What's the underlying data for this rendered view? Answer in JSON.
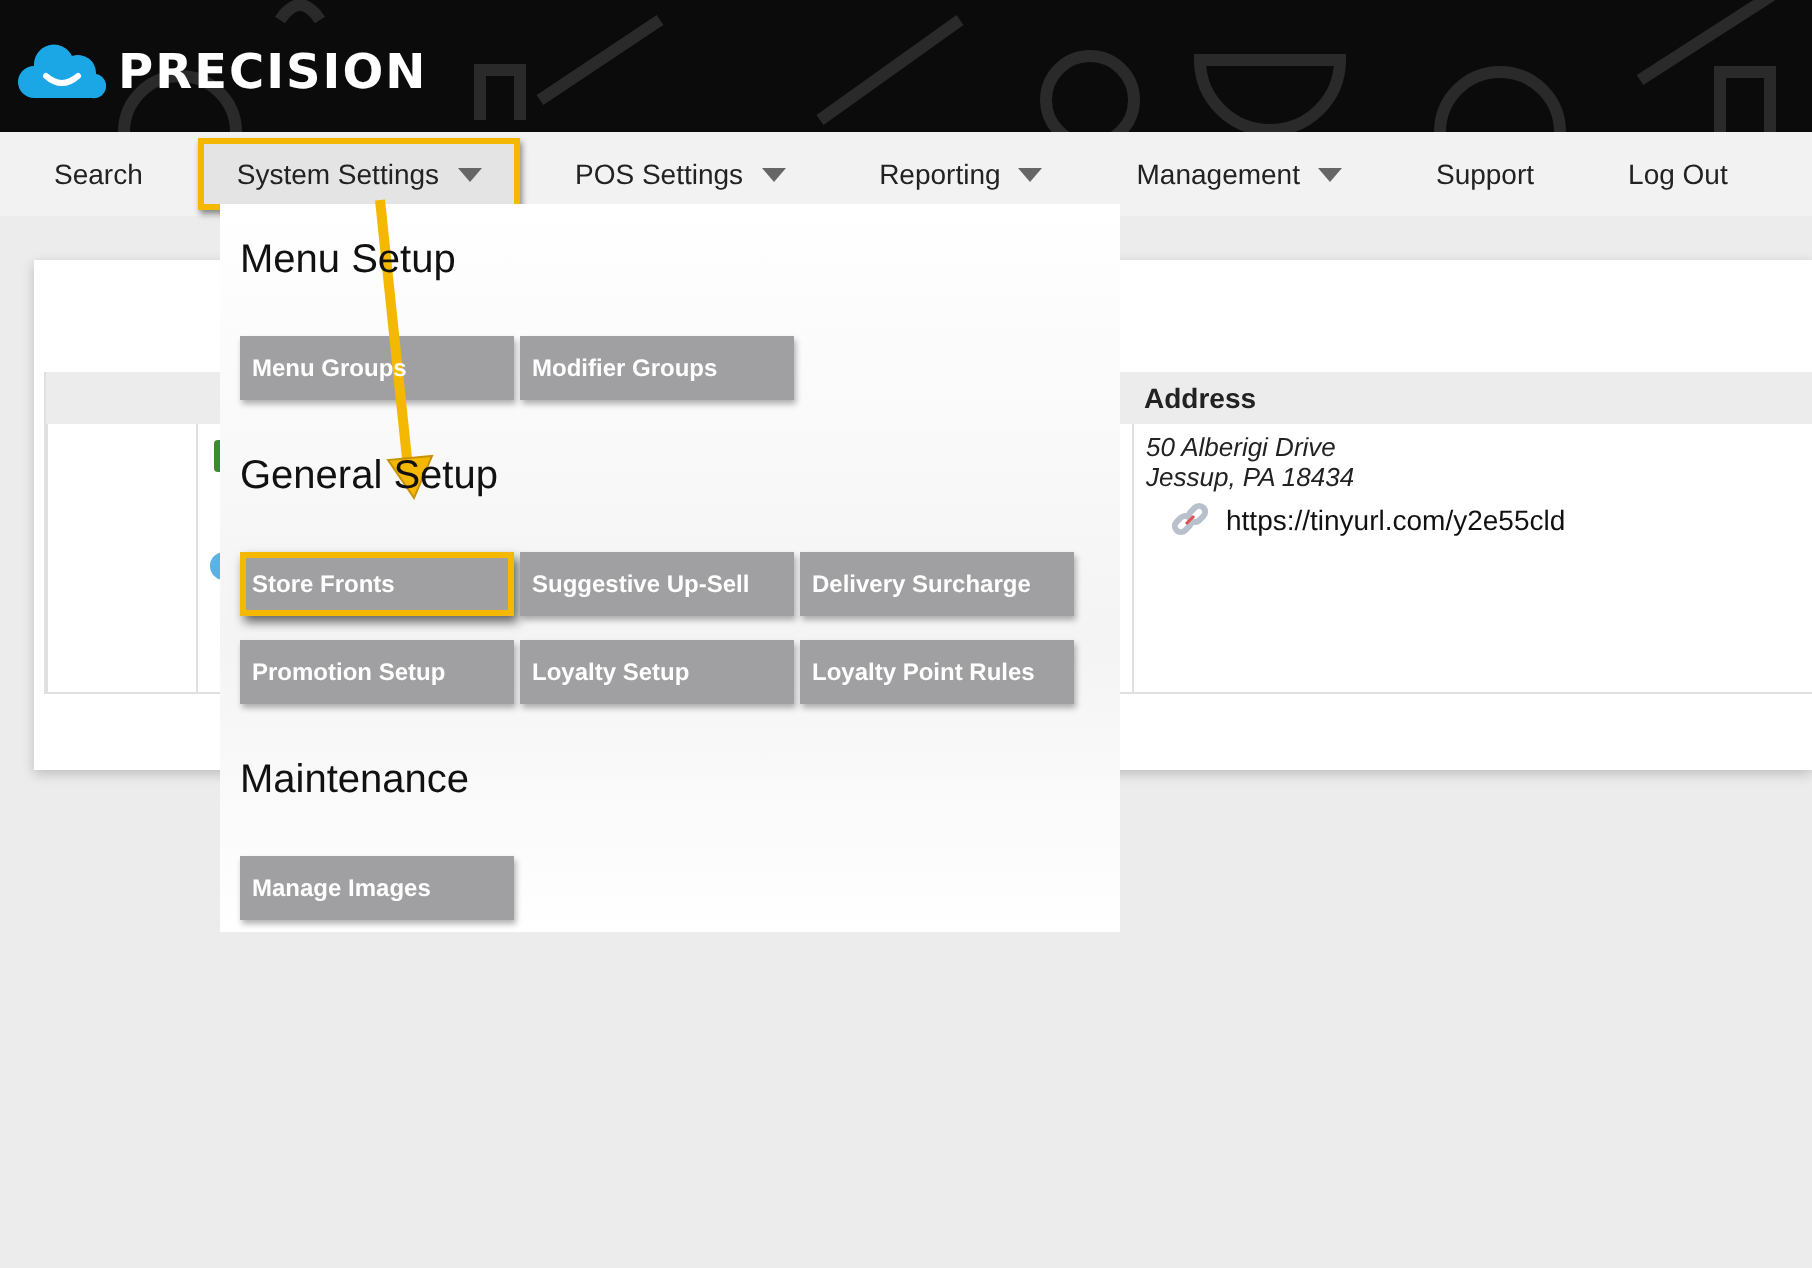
{
  "header": {
    "logo_text": "PRECISION"
  },
  "nav": [
    {
      "label": "Search",
      "has_menu": false,
      "selected": false,
      "highlighted": false
    },
    {
      "label": "System Settings",
      "has_menu": true,
      "selected": true,
      "highlighted": true
    },
    {
      "label": "POS Settings",
      "has_menu": true,
      "selected": false,
      "highlighted": false
    },
    {
      "label": "Reporting",
      "has_menu": true,
      "selected": false,
      "highlighted": false
    },
    {
      "label": "Management",
      "has_menu": true,
      "selected": false,
      "highlighted": false
    },
    {
      "label": "Support",
      "has_menu": false,
      "selected": false,
      "highlighted": false
    },
    {
      "label": "Log Out",
      "has_menu": false,
      "selected": false,
      "highlighted": false
    }
  ],
  "dropdown": {
    "sections": [
      {
        "title": "Menu Setup",
        "items": [
          {
            "label": "Menu Groups",
            "highlighted": false
          },
          {
            "label": "Modifier Groups",
            "highlighted": false
          }
        ]
      },
      {
        "title": "General Setup",
        "items": [
          {
            "label": "Store Fronts",
            "highlighted": true
          },
          {
            "label": "Suggestive Up-Sell",
            "highlighted": false
          },
          {
            "label": "Delivery Surcharge",
            "highlighted": false
          },
          {
            "label": "Promotion Setup",
            "highlighted": false
          },
          {
            "label": "Loyalty Setup",
            "highlighted": false
          },
          {
            "label": "Loyalty Point Rules",
            "highlighted": false
          }
        ]
      },
      {
        "title": "Maintenance",
        "items": [
          {
            "label": "Manage Images",
            "highlighted": false
          }
        ]
      }
    ]
  },
  "table": {
    "columns": [
      {
        "label": "Address"
      }
    ],
    "row": {
      "address_lines": [
        "50 Alberigi Drive",
        "Jessup, PA 18434"
      ],
      "link": "https://tinyurl.com/y2e55cld"
    }
  }
}
